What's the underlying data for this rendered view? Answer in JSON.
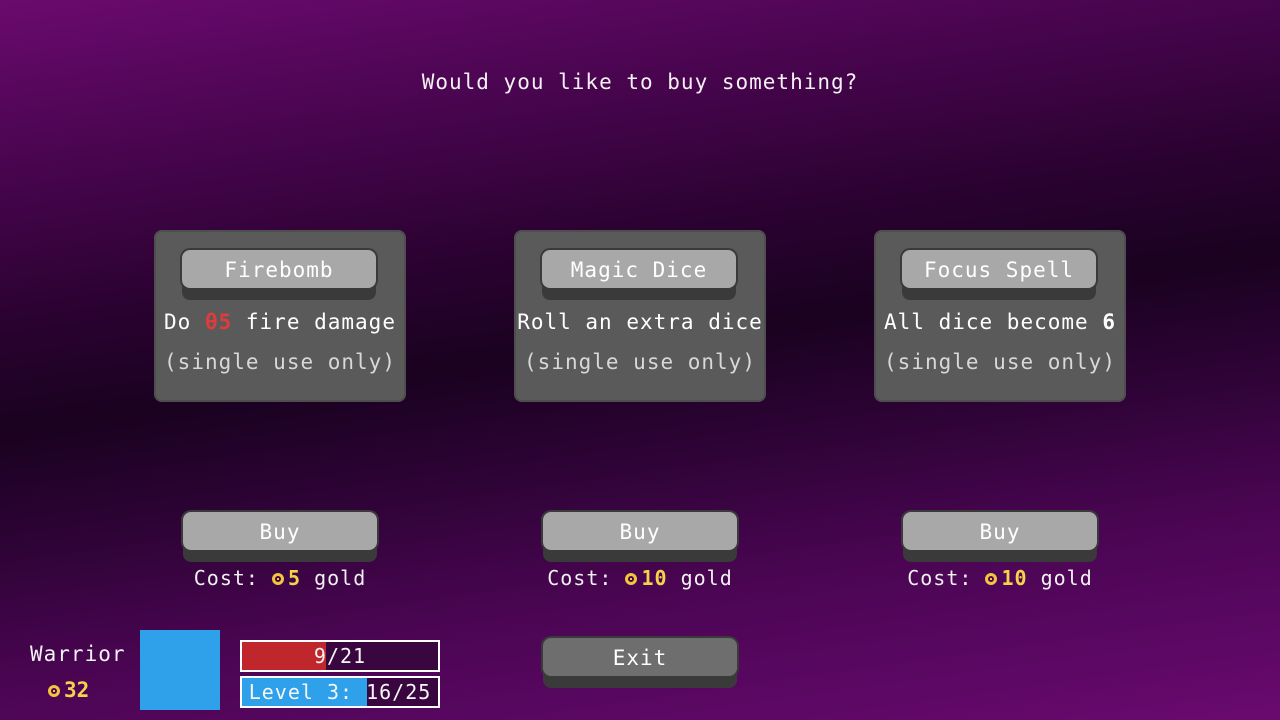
{
  "shop": {
    "title": "Would you like to buy something?"
  },
  "items": [
    {
      "name": "Firebomb",
      "desc_pre": "Do ",
      "desc_value": "θ5",
      "desc_post": " fire damage",
      "note": "(single use only)",
      "buy_label": "Buy",
      "cost_label": "Cost: ",
      "cost_value": "5",
      "cost_unit": " gold"
    },
    {
      "name": "Magic Dice",
      "desc": "Roll an extra dice",
      "note": "(single use only)",
      "buy_label": "Buy",
      "cost_label": "Cost: ",
      "cost_value": "10",
      "cost_unit": " gold"
    },
    {
      "name": "Focus Spell",
      "desc_pre": "All dice become ",
      "desc_value": "6",
      "note": "(single use only)",
      "buy_label": "Buy",
      "cost_label": "Cost: ",
      "cost_value": "10",
      "cost_unit": " gold"
    }
  ],
  "exit_label": "Exit",
  "player": {
    "class_name": "Warrior",
    "gold": "32",
    "health_text": "9/21",
    "health_fraction": 0.43,
    "level_text": "Level 3: 16/25",
    "xp_fraction": 0.64
  },
  "colors": {
    "health": "#c0272d",
    "xp": "#2fa0ea",
    "gold": "#f6d24a",
    "damage": "#e23b3b",
    "portrait": "#2fa0ea"
  },
  "icons": {
    "gold": "gold-coin-icon",
    "damage": "damage-icon"
  }
}
